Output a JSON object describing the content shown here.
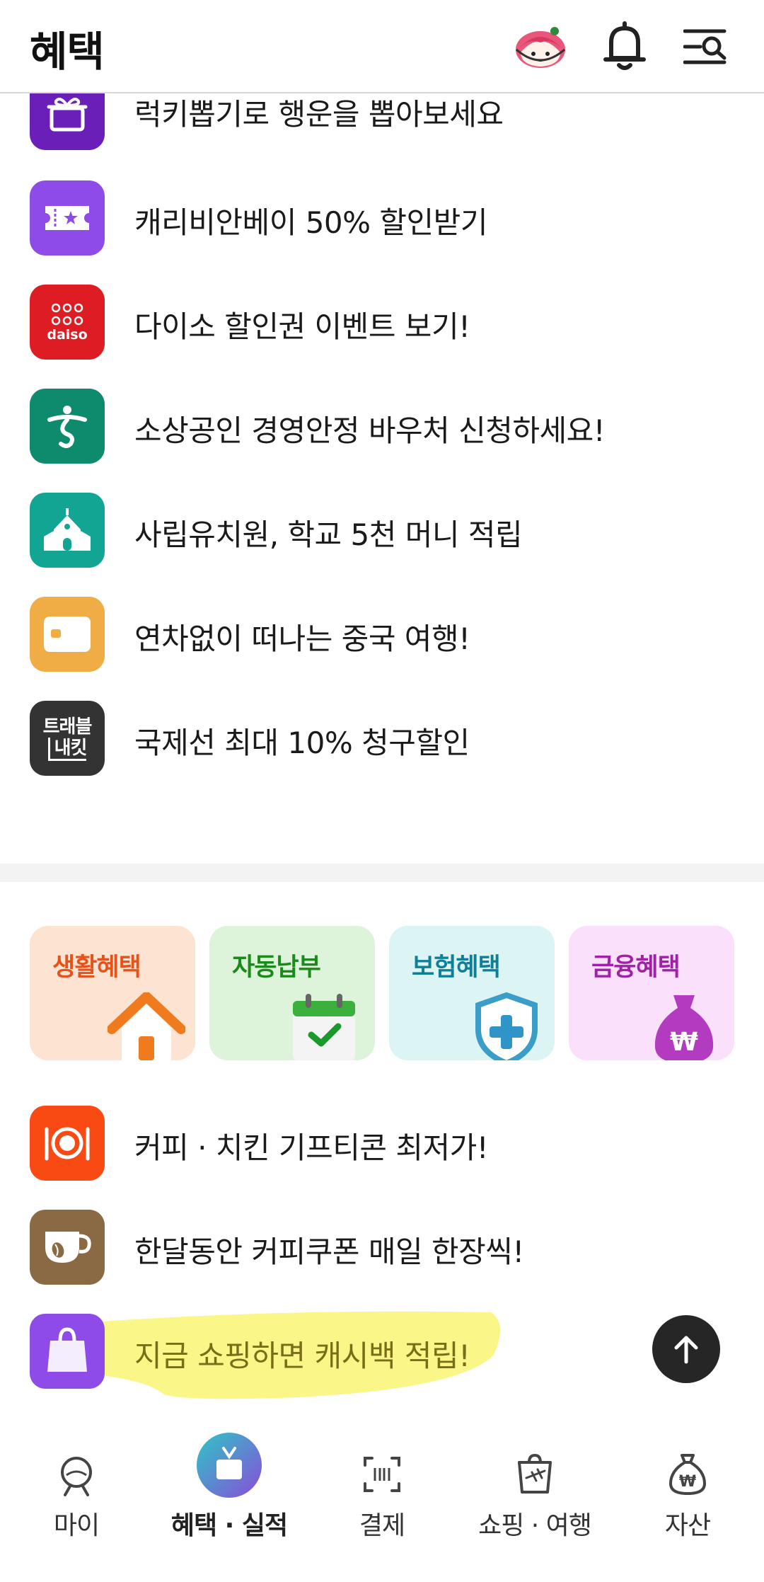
{
  "header": {
    "title": "혜택",
    "avatar_icon": "character-avatar-icon",
    "bell_icon": "bell-icon",
    "menu_icon": "menu-search-icon"
  },
  "list_top": [
    {
      "label": "럭키뽑기로 행운을 뽑아보세요",
      "icon": "gift-box-icon",
      "color": "#6a1fb8"
    },
    {
      "label": "캐리비안베이 50% 할인받기",
      "icon": "ticket-icon",
      "color": "#8e4be8"
    },
    {
      "label": "다이소 할인권 이벤트 보기!",
      "icon": "daiso-logo",
      "icon_text": "daiso",
      "color": "#dd1c24"
    },
    {
      "label": "소상공인 경영안정 바우처 신청하세요!",
      "icon": "person-emblem-icon",
      "color": "#0e8a6d"
    },
    {
      "label": "사립유치원, 학교 5천 머니 적립",
      "icon": "school-icon",
      "color": "#12a594"
    },
    {
      "label": "연차없이 떠나는 중국 여행!",
      "icon": "card-icon",
      "color": "#f0ad45"
    },
    {
      "label": "국제선 최대 10% 청구할인",
      "icon": "travel-kit-logo",
      "icon_text": [
        "트래블",
        "내킷"
      ],
      "color": "#333333"
    }
  ],
  "categories": [
    {
      "label": "생활혜택",
      "icon": "house-icon",
      "bg": "#fde3d2",
      "fg": "#e5531a"
    },
    {
      "label": "자동납부",
      "icon": "calendar-check-icon",
      "bg": "#ddf3da",
      "fg": "#1a8a1a"
    },
    {
      "label": "보험혜택",
      "icon": "shield-plus-icon",
      "bg": "#dcf4f4",
      "fg": "#0f7f99"
    },
    {
      "label": "금융혜택",
      "icon": "money-bag-icon",
      "bg": "#fbe0fb",
      "fg": "#a020a8"
    }
  ],
  "list_bottom": [
    {
      "label": "커피 · 치킨 기프티콘 최저가!",
      "icon": "dining-icon",
      "color": "#fa4a14"
    },
    {
      "label": "한달동안 커피쿠폰 매일 한장씩!",
      "icon": "coffee-cup-icon",
      "color": "#8a6a44"
    },
    {
      "label": "지금 쇼핑하면 캐시백 적립!",
      "icon": "shopping-bag-icon",
      "color": "#8e4be8",
      "highlighted": true
    }
  ],
  "scroll_top_icon": "arrow-up-icon",
  "bottom_nav": [
    {
      "label": "마이",
      "icon": "my-face-icon",
      "active": false
    },
    {
      "label": "혜택 · 실적",
      "icon": "benefit-gift-icon",
      "active": true
    },
    {
      "label": "결제",
      "icon": "barcode-scan-icon",
      "active": false
    },
    {
      "label": "쇼핑 · 여행",
      "icon": "shopping-travel-icon",
      "active": false
    },
    {
      "label": "자산",
      "icon": "won-bag-icon",
      "active": false
    }
  ]
}
